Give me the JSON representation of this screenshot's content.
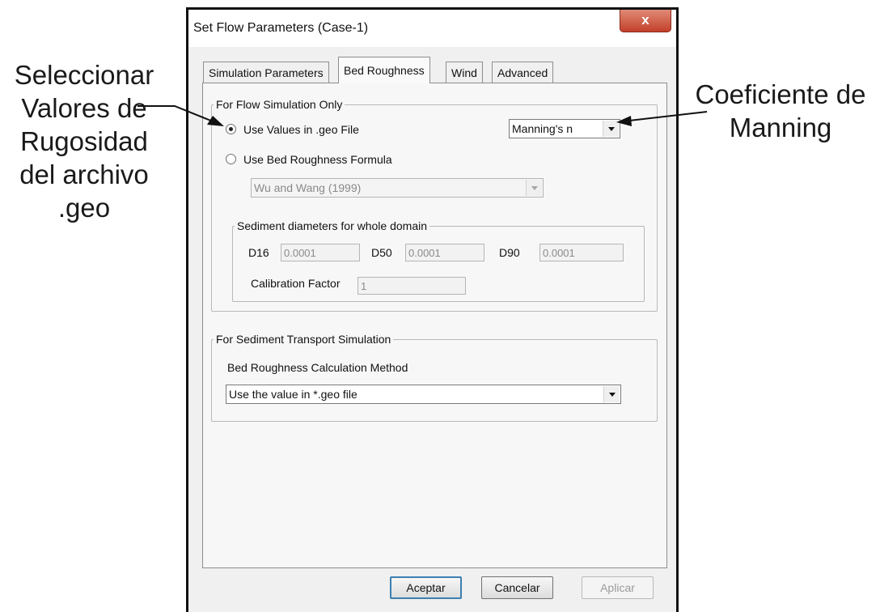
{
  "annotations": {
    "left": [
      "Seleccionar",
      "Valores de",
      "Rugosidad",
      "del archivo",
      ".geo"
    ],
    "right": [
      "Coeficiente de",
      "Manning"
    ]
  },
  "window": {
    "title": "Set Flow Parameters (Case-1)",
    "close_label": "x"
  },
  "tabs": [
    {
      "label": "Simulation Parameters",
      "active": false
    },
    {
      "label": "Bed Roughness",
      "active": true
    },
    {
      "label": "Wind",
      "active": false
    },
    {
      "label": "Advanced",
      "active": false
    }
  ],
  "flow_group": {
    "legend": "For Flow Simulation Only",
    "radio_geo": {
      "label": "Use Values in .geo File",
      "checked": true
    },
    "radio_formula": {
      "label": "Use Bed Roughness Formula",
      "checked": false
    },
    "coefficient_select": {
      "value": "Manning's n"
    },
    "formula_select": {
      "value": "Wu and Wang (1999)",
      "enabled": false
    }
  },
  "sediment_group": {
    "legend": "Sediment diameters for whole domain",
    "d16_label": "D16",
    "d16_value": "0.0001",
    "d50_label": "D50",
    "d50_value": "0.0001",
    "d90_label": "D90",
    "d90_value": "0.0001",
    "calibration_label": "Calibration Factor",
    "calibration_value": "1"
  },
  "transport_group": {
    "legend": "For Sediment Transport Simulation",
    "method_label": "Bed Roughness Calculation Method",
    "method_select": {
      "value": "Use the value in *.geo file"
    }
  },
  "buttons": {
    "accept": "Aceptar",
    "cancel": "Cancelar",
    "apply": "Aplicar"
  },
  "colors": {
    "close_button": "#c3402a",
    "window_bg": "#f0f0f0",
    "default_button_border": "#3c7fb1"
  },
  "icons": {
    "close": "close-icon",
    "dropdown": "chevron-down-icon",
    "annotation_arrow": "arrow-icon"
  }
}
